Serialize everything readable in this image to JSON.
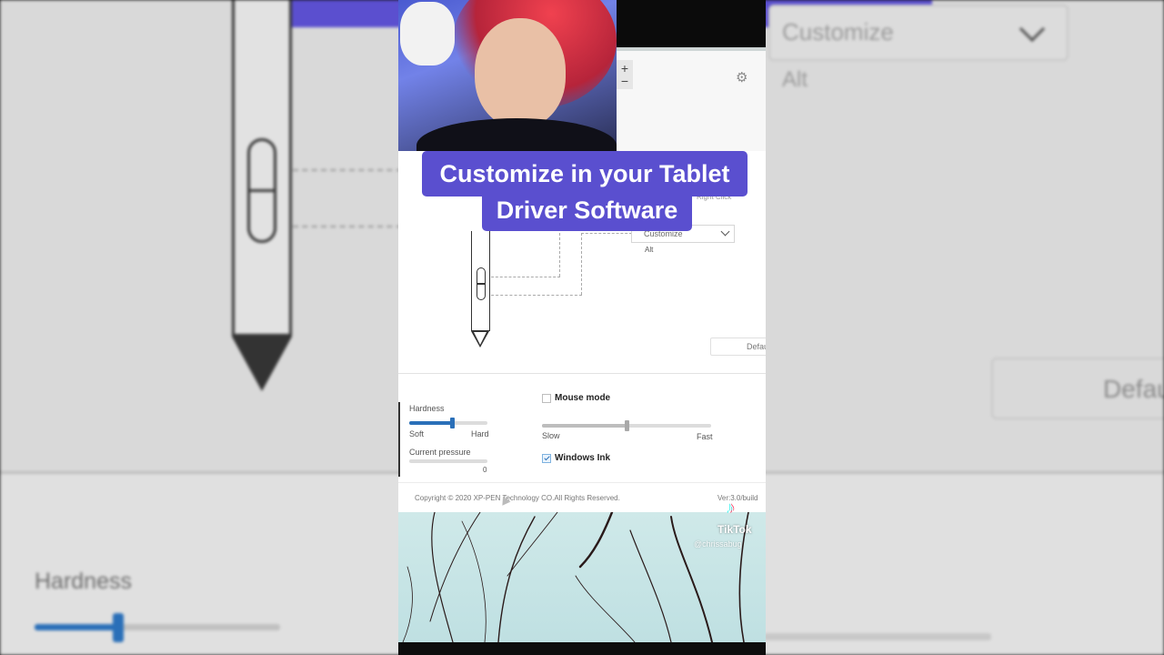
{
  "background": {
    "select_value": "Customize",
    "alt_label": "Alt",
    "default_label": "Defau",
    "hardness_label": "Hardness"
  },
  "overlay": {
    "banner_line1": "Customize in your Tablet",
    "banner_line2": "Driver Software",
    "colors": {
      "banner": "#5a4fcf",
      "slider_accent": "#2a6fb8"
    }
  },
  "driver": {
    "plus_minus": "+\n−",
    "settings_icon": "gear-icon",
    "button_function": {
      "right_click_label": "Right Click",
      "select_value": "Customize",
      "key_label": "Alt",
      "default_button": "Defau"
    },
    "pressure": {
      "hardness_label": "Hardness",
      "hardness_value": 0.55,
      "soft_label": "Soft",
      "hard_label": "Hard",
      "current_pressure_label": "Current pressure",
      "current_pressure_value": "0"
    },
    "mouse_mode": {
      "label": "Mouse mode",
      "checked": false,
      "speed_value": 0.5,
      "slow_label": "Slow",
      "fast_label": "Fast"
    },
    "windows_ink": {
      "label": "Windows Ink",
      "checked": true
    },
    "footer": {
      "copyright": "Copyright © 2020 XP-PEN Technology CO.All Rights Reserved.",
      "version": "Ver:3.0/build"
    }
  },
  "tiktok": {
    "logo_glyph": "♪",
    "wordmark": "TikTok",
    "handle": "@chrissabug"
  }
}
